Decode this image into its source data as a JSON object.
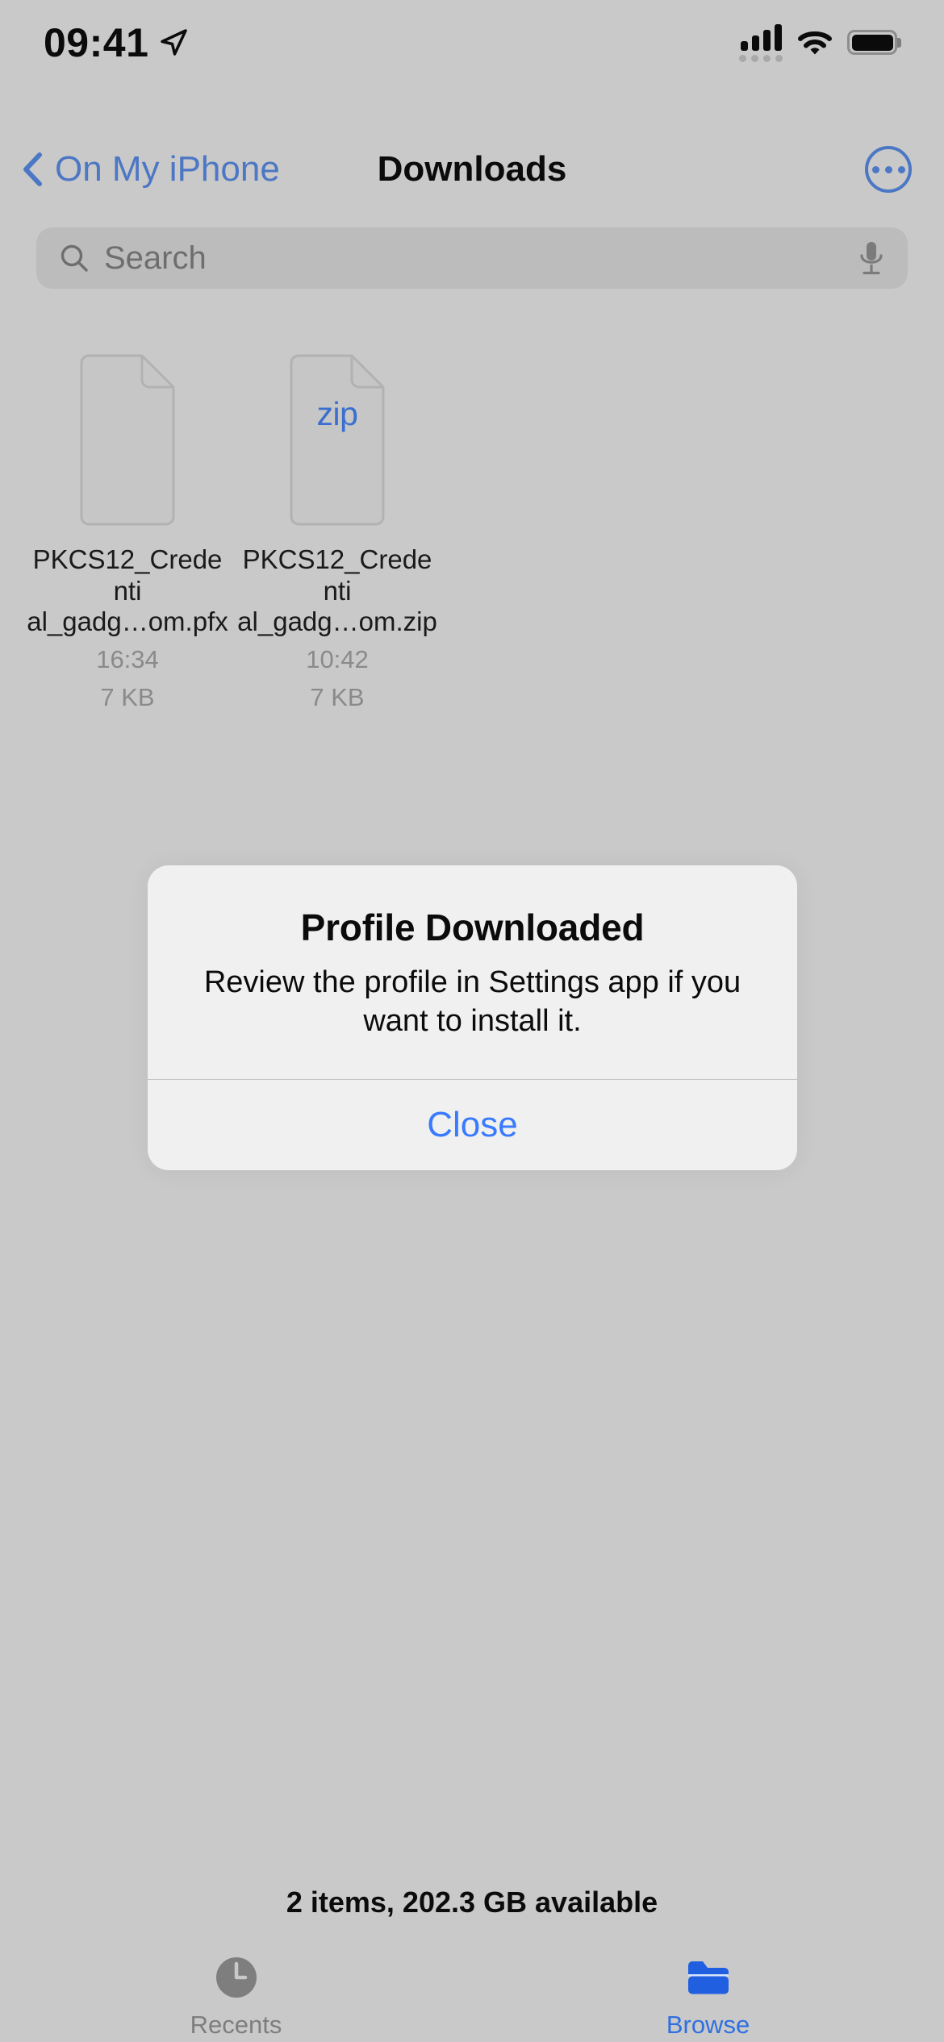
{
  "status_bar": {
    "time": "09:41",
    "location_icon": "location-arrow-icon",
    "cellular_icon": "cellular-bars-icon",
    "wifi_icon": "wifi-icon",
    "battery_icon": "battery-full-icon"
  },
  "nav": {
    "back_label": "On My iPhone",
    "back_icon": "chevron-left-icon",
    "title": "Downloads",
    "more_icon": "ellipsis-circle-icon"
  },
  "search": {
    "placeholder": "Search",
    "search_icon": "magnifying-glass-icon",
    "mic_icon": "microphone-icon"
  },
  "files": [
    {
      "icon": "document-icon",
      "badge": "",
      "name": "PKCS12_Credential_gadg…om.pfx",
      "name_line1": "PKCS12_Credenti",
      "name_line2": "al_gadg…om.pfx",
      "time": "16:34",
      "size": "7 KB"
    },
    {
      "icon": "zip-document-icon",
      "badge": "zip",
      "name": "PKCS12_Credential_gadg…om.zip",
      "name_line1": "PKCS12_Credenti",
      "name_line2": "al_gadg…om.zip",
      "time": "10:42",
      "size": "7 KB"
    }
  ],
  "dialog": {
    "title": "Profile Downloaded",
    "message": "Review the profile in Settings app if you want to install it.",
    "action_label": "Close"
  },
  "footer": {
    "status": "2 items, 202.3 GB available"
  },
  "tabs": [
    {
      "label": "Recents",
      "icon": "clock-icon",
      "selected": false
    },
    {
      "label": "Browse",
      "icon": "folder-icon",
      "selected": true
    }
  ],
  "colors": {
    "background": "#c9c9c9",
    "accent_blue": "#3a7afe",
    "nav_blue": "#4c77c4",
    "tab_blue": "#2f6fe0",
    "dialog_bg": "#eff0ef",
    "secondary_text": "#8a8a8a"
  }
}
